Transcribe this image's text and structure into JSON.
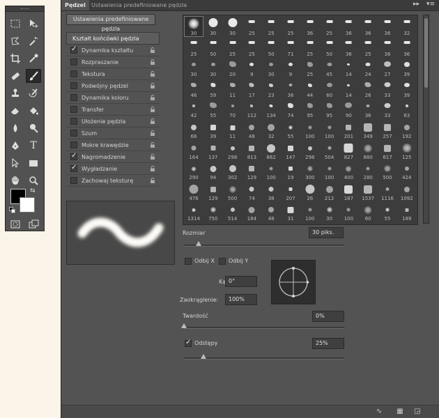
{
  "panel": {
    "tabs": [
      {
        "label": "Pędzel"
      },
      {
        "label": "Ustawienia predefiniowane pędzla"
      }
    ],
    "collapse_icon": "double-chevron-right",
    "menu_icon": "panel-menu"
  },
  "presets_button": "Ustawienia predefiniowane pędzla",
  "options": {
    "header": "Kształt końcówki pędzla",
    "items": [
      {
        "label": "Dynamika kształtu",
        "checked": true
      },
      {
        "label": "Rozpraszanie",
        "checked": false
      },
      {
        "label": "Tekstura",
        "checked": false
      },
      {
        "label": "Podwójny pędzel",
        "checked": false
      },
      {
        "label": "Dynamika koloru",
        "checked": false
      },
      {
        "label": "Transfer",
        "checked": false
      },
      {
        "label": "Ułożenie pędzla",
        "checked": false
      },
      {
        "label": "Szum",
        "checked": false
      },
      {
        "label": "Mokre krawędzie",
        "checked": false
      },
      {
        "label": "Nagromadzenie",
        "checked": true
      },
      {
        "label": "Wygładzanie",
        "checked": true
      },
      {
        "label": "Zachowaj teksturę",
        "checked": false
      }
    ]
  },
  "brush_tips": [
    "30",
    "30",
    "30",
    "25",
    "25",
    "25",
    "36",
    "25",
    "36",
    "36",
    "36",
    "32",
    "25",
    "50",
    "25",
    "25",
    "50",
    "71",
    "25",
    "50",
    "36",
    "25",
    "36",
    "36",
    "30",
    "30",
    "20",
    "9",
    "30",
    "9",
    "25",
    "45",
    "14",
    "24",
    "27",
    "39",
    "46",
    "59",
    "11",
    "17",
    "23",
    "36",
    "44",
    "60",
    "14",
    "26",
    "33",
    "39",
    "42",
    "55",
    "70",
    "112",
    "134",
    "74",
    "95",
    "95",
    "90",
    "36",
    "33",
    "63",
    "66",
    "39",
    "11",
    "48",
    "32",
    "55",
    "100",
    "100",
    "201",
    "349",
    "257",
    "192",
    "164",
    "137",
    "298",
    "813",
    "862",
    "147",
    "298",
    "504",
    "827",
    "880",
    "617",
    "125",
    "290",
    "94",
    "302",
    "129",
    "100",
    "19",
    "300",
    "100",
    "400",
    "280",
    "500",
    "424",
    "476",
    "129",
    "500",
    "74",
    "38",
    "207",
    "26",
    "212",
    "187",
    "1537",
    "1116",
    "1092",
    "1314",
    "750",
    "514",
    "184",
    "48",
    "31",
    "100",
    "30",
    "100",
    "60",
    "55",
    "189"
  ],
  "size": {
    "label": "Rozmiar",
    "value": "30 piks.",
    "fraction": 0.09
  },
  "flip_x": {
    "label": "Odbij X",
    "checked": false
  },
  "flip_y": {
    "label": "Odbij Y",
    "checked": false
  },
  "angle": {
    "label": "Kąt:",
    "value": "0°"
  },
  "roundness": {
    "label": "Zaokrąglenie:",
    "value": "100%"
  },
  "hardness": {
    "label": "Twardość",
    "value": "0%",
    "fraction": 0.0
  },
  "spacing": {
    "label": "Odstępy",
    "value": "25%",
    "checked": true,
    "fraction": 0.12
  },
  "bottom_icons": [
    "brush-toggle-icon",
    "grid-icon",
    "new-brush-icon"
  ],
  "tools": {
    "swap_icon": "swap-colors-icon",
    "foreground_color": "#000000",
    "background_color": "#ffffff"
  }
}
